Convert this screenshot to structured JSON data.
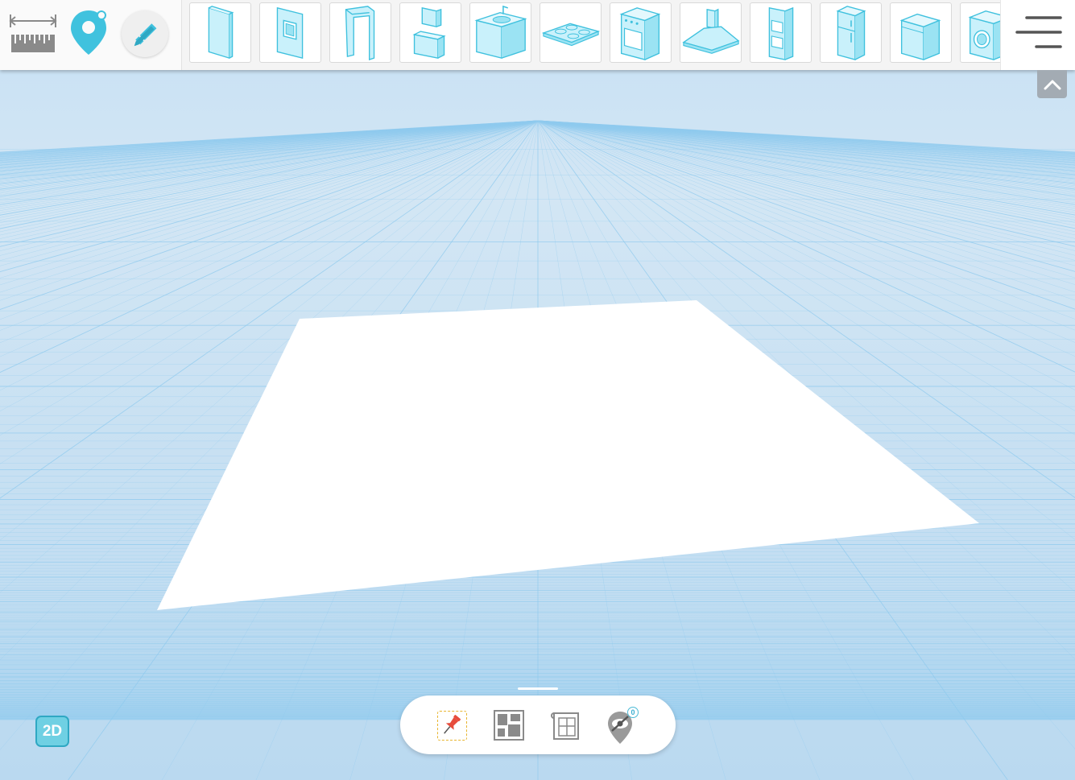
{
  "colors": {
    "accent": "#4bbad6",
    "icon_stroke": "#3fc1de",
    "icon_fill": "#c9f1fb",
    "grid_line": "#8fcaee",
    "floor": "#ffffff"
  },
  "toolbar": {
    "tools": [
      {
        "name": "measure-ruler-icon"
      },
      {
        "name": "location-pin-icon"
      },
      {
        "name": "pencil-ruler-icon"
      }
    ],
    "catalog": [
      {
        "name": "wall-panel-icon"
      },
      {
        "name": "window-icon"
      },
      {
        "name": "doorway-icon"
      },
      {
        "name": "cabinet-stack-icon"
      },
      {
        "name": "sink-cabinet-icon"
      },
      {
        "name": "cooktop-icon"
      },
      {
        "name": "stove-oven-icon"
      },
      {
        "name": "range-hood-icon"
      },
      {
        "name": "tall-oven-cabinet-icon"
      },
      {
        "name": "refrigerator-icon"
      },
      {
        "name": "dishwasher-icon"
      },
      {
        "name": "washing-machine-icon"
      }
    ],
    "menu": {
      "name": "hamburger-menu-icon"
    }
  },
  "view_toggle": {
    "label": "2D"
  },
  "bottom_bar": {
    "buttons": [
      {
        "name": "pin-icon",
        "color": "#e74c3c"
      },
      {
        "name": "floor-layout-icon"
      },
      {
        "name": "blueprint-icon"
      },
      {
        "name": "hidden-markers-icon"
      }
    ],
    "hidden_count": "0"
  }
}
